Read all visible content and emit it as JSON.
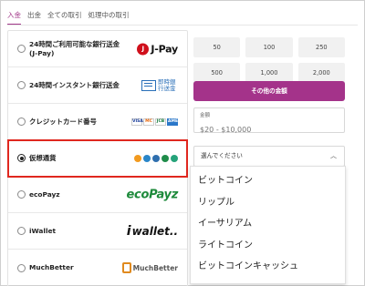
{
  "tabs": [
    {
      "label": "入金",
      "active": true
    },
    {
      "label": "出金",
      "active": false
    },
    {
      "label": "全ての取引",
      "active": false
    },
    {
      "label": "処理中の取引",
      "active": false
    }
  ],
  "methods": [
    {
      "label": "24時間ご利用可能な銀行送金(J-Pay)",
      "logo": "J-Pay"
    },
    {
      "label": "24時間インスタント銀行送金",
      "logo": "即時銀行送金"
    },
    {
      "label": "クレジットカード番号",
      "logo": "card-logos"
    },
    {
      "label": "仮想通貨",
      "logo": "crypto-coins"
    },
    {
      "label": "ecoPayz",
      "logo": "ecoPayz"
    },
    {
      "label": "iWallet",
      "logo": "iwallet..."
    },
    {
      "label": "MuchBetter",
      "logo": "MuchBetter"
    }
  ],
  "selected_method_index": 3,
  "amounts": [
    "50",
    "100",
    "250",
    "500",
    "1,000",
    "2,000"
  ],
  "other_amount_button": "その他の金額",
  "amount_field": {
    "label": "金額",
    "placeholder": "$20 - $10,000"
  },
  "currency_select": {
    "placeholder": "選んでください"
  },
  "currency_options": [
    "ビットコイン",
    "リップル",
    "イーサリアム",
    "ライトコイン",
    "ビットコインキャッシュ"
  ],
  "colors": {
    "accent": "#a4338a",
    "highlight": "#e0271f"
  },
  "logos": {
    "jpay_mark": "J",
    "jpay_text": "J-Pay",
    "bank_text": "即時銀行送金",
    "cards": [
      "VISA",
      "MC",
      "JCB",
      "AMEX"
    ],
    "ecopayz": "ecoPayz",
    "iwallet": "wallet..",
    "muchbetter": "MuchBetter"
  }
}
